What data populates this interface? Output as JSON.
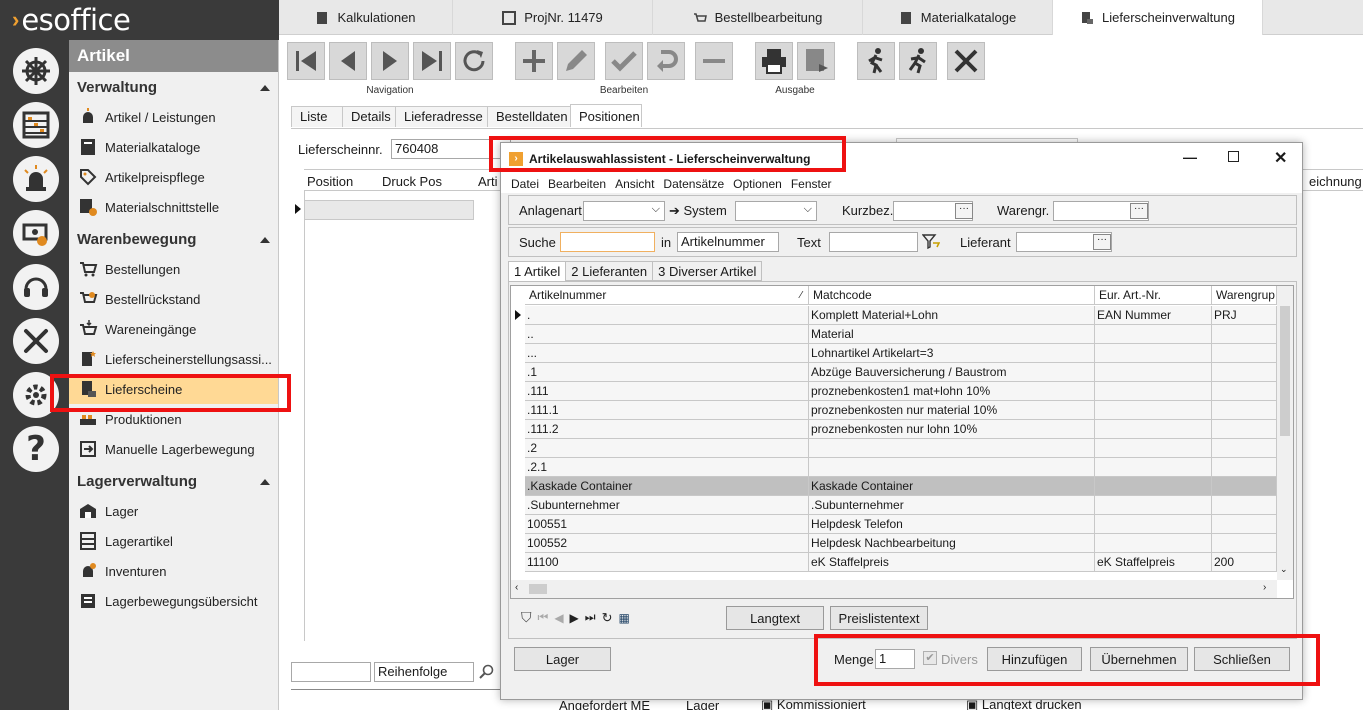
{
  "app": {
    "logo": "esoffice"
  },
  "nav": {
    "header": "Artikel",
    "sections": [
      {
        "title": "Verwaltung",
        "items": [
          "Artikel / Leistungen",
          "Materialkataloge",
          "Artikelpreispflege",
          "Materialschnittstelle"
        ]
      },
      {
        "title": "Warenbewegung",
        "items": [
          "Bestellungen",
          "Bestellrückstand",
          "Wareneingänge",
          "Lieferscheinerstellungsassi...",
          "Lieferscheine",
          "Produktionen",
          "Manuelle Lagerbewegung"
        ]
      },
      {
        "title": "Lagerverwaltung",
        "items": [
          "Lager",
          "Lagerartikel",
          "Inventuren",
          "Lagerbewegungsübersicht"
        ]
      }
    ],
    "selected": "Lieferscheine"
  },
  "rail_icons": [
    "helm-icon",
    "abacus-icon",
    "alarm-light-icon",
    "cash-icon",
    "headset-icon",
    "tools-icon",
    "gears-icon",
    "help-icon"
  ],
  "top_tabs": [
    "Kalkulationen",
    "ProjNr. 11479",
    "Bestellbearbeitung",
    "Materialkataloge",
    "Lieferscheinverwaltung"
  ],
  "toolbar": {
    "navigation": "Navigation",
    "bearbeiten": "Bearbeiten",
    "ausgabe": "Ausgabe"
  },
  "inner_tabs": [
    "Liste",
    "Details",
    "Lieferadresse",
    "Bestelldaten",
    "Positionen"
  ],
  "form": {
    "lieferschein_label": "Lieferscheinnr.",
    "lieferschein_value": "760408",
    "col_position": "Position",
    "col_druck": "Druck Pos",
    "col_arti": "Arti",
    "col_bezeichnung": "eichnung",
    "reihenfolge": "Reihenfolge",
    "bottom_angefordert": "Angefordert ME",
    "bottom_lager": "Lager",
    "bottom_kommissioniert": "Kommissioniert",
    "bottom_langtext": "Langtext drucken"
  },
  "dialog": {
    "title": "Artikelauswahlassistent - Lieferscheinverwaltung",
    "menu": [
      "Datei",
      "Bearbeiten",
      "Ansicht",
      "Datensätze",
      "Optionen",
      "Fenster"
    ],
    "anlagenart": "Anlagenart",
    "system": "System",
    "kurzbez": "Kurzbez.",
    "warengr": "Warengr.",
    "suche": "Suche",
    "in": "in",
    "in_value": "Artikelnummer",
    "text": "Text",
    "lieferant": "Lieferant",
    "tabs": [
      "1 Artikel",
      "2 Lieferanten",
      "3 Diverser Artikel"
    ],
    "columns": [
      "Artikelnummer",
      "Matchcode",
      "Eur. Art.-Nr.",
      "Warengrup"
    ],
    "rows": [
      [
        ".",
        "Komplett Material+Lohn",
        "EAN Nummer",
        "PRJ"
      ],
      [
        "..",
        "Material",
        "",
        ""
      ],
      [
        "...",
        "Lohnartikel Artikelart=3",
        "",
        ""
      ],
      [
        ".1",
        "Abzüge Bauversicherung / Baustrom",
        "",
        ""
      ],
      [
        ".111",
        "proznebenkosten1 mat+lohn 10%",
        "",
        ""
      ],
      [
        ".111.1",
        "proznebenkosten nur material 10%",
        "",
        ""
      ],
      [
        ".111.2",
        "proznebenkosten nur lohn 10%",
        "",
        ""
      ],
      [
        ".2",
        "",
        "",
        ""
      ],
      [
        ".2.1",
        "",
        "",
        ""
      ],
      [
        ".Kaskade Container",
        "Kaskade Container",
        "",
        ""
      ],
      [
        ".Subunternehmer",
        ".Subunternehmer",
        "",
        ""
      ],
      [
        "100551",
        "Helpdesk Telefon",
        "",
        ""
      ],
      [
        "100552",
        "Helpdesk Nachbearbeitung",
        "",
        ""
      ],
      [
        "11100",
        "eK Staffelpreis",
        "eK Staffelpreis",
        "200"
      ]
    ],
    "langtext": "Langtext",
    "preislistentext": "Preislistentext",
    "lager": "Lager",
    "menge": "Menge",
    "menge_value": "1",
    "divers": "Divers",
    "hinzufuegen": "Hinzufügen",
    "uebernehmen": "Übernehmen",
    "schliessen": "Schließen"
  }
}
